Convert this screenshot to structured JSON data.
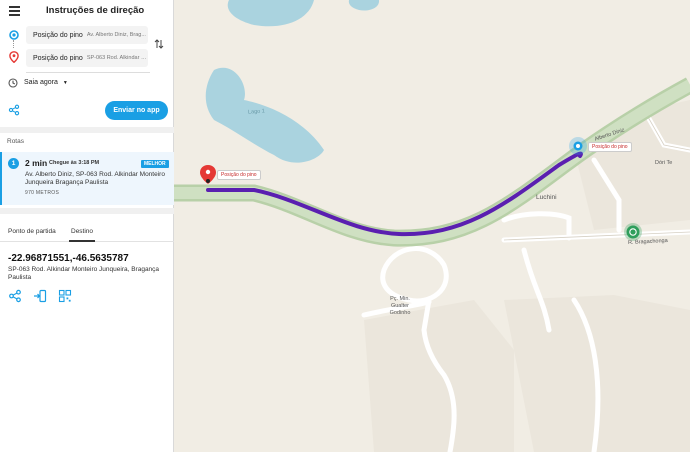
{
  "header": {
    "title": "Instruções de direção"
  },
  "waypoints": [
    {
      "main": "Posição do pino",
      "sub": "Av. Alberto Diniz, Brag..."
    },
    {
      "main": "Posição do pino",
      "sub": "SP-063 Rod. Alkindar M..."
    }
  ],
  "departure": {
    "label": "Saia agora"
  },
  "send_button": "Enviar no app",
  "routes": {
    "label": "Rotas",
    "items": [
      {
        "number": "1",
        "time": "2 min",
        "arrival": "Chegue às 3:18 PM",
        "badge": "MELHOR",
        "description": "Av. Alberto Diniz, SP-063 Rod. Alkindar Monteiro Junqueira Bragança Paulista",
        "distance": "970 METROS"
      }
    ]
  },
  "tabs": {
    "start": "Ponto de partida",
    "destination": "Destino"
  },
  "destination": {
    "coords": "-22.96871551,-46.5635787",
    "address": "SP-063 Rod. Alkindar Monteiro Junqueira, Bragança Paulista"
  },
  "map": {
    "pin_label_start": "Posição do pino",
    "pin_label_end": "Posição do pino",
    "labels": {
      "lake": "Lago 1",
      "street_diniz": "Alberto Diniz",
      "neighborhood": "Luchini",
      "street_right": "Dóri Te",
      "bragachonga": "R. Bragachonga",
      "plaza": "Pç. Min. Gualter Godinho"
    }
  },
  "colors": {
    "accent": "#1a9fe4",
    "route": "#5a1fb0",
    "water": "#aad3df",
    "pin_red": "#e53935",
    "pin_green": "#2e9e5b"
  }
}
